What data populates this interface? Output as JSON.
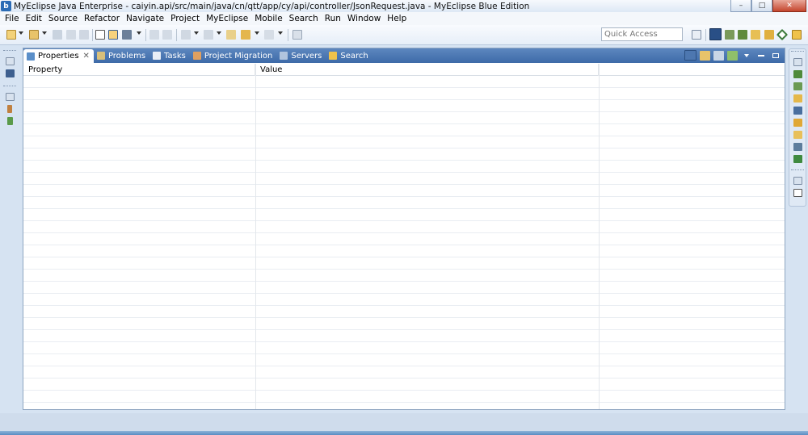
{
  "window": {
    "title": "MyEclipse Java Enterprise - caiyin.api/src/main/java/cn/qtt/app/cy/api/controller/JsonRequest.java - MyEclipse Blue Edition",
    "minimize_symbol": "–",
    "maximize_symbol": "□",
    "close_symbol": "✕"
  },
  "menu": [
    "File",
    "Edit",
    "Source",
    "Refactor",
    "Navigate",
    "Project",
    "MyEclipse",
    "Mobile",
    "Search",
    "Run",
    "Window",
    "Help"
  ],
  "quick_access": {
    "placeholder": "Quick Access"
  },
  "tabs": [
    {
      "label": "Properties",
      "icon": "properties-icon",
      "color": "#5b8fc9",
      "active": true,
      "close": "✕"
    },
    {
      "label": "Problems",
      "icon": "problems-icon",
      "color": "#d9c07a",
      "active": false
    },
    {
      "label": "Tasks",
      "icon": "tasks-icon",
      "color": "#e8eef7",
      "active": false
    },
    {
      "label": "Project Migration",
      "icon": "migration-icon",
      "color": "#e0a060",
      "active": false
    },
    {
      "label": "Servers",
      "icon": "servers-icon",
      "color": "#b0c4de",
      "active": false
    },
    {
      "label": "Search",
      "icon": "search-icon",
      "color": "#f0c24b",
      "active": false
    }
  ],
  "table": {
    "columns": [
      "Property",
      "Value",
      ""
    ]
  }
}
